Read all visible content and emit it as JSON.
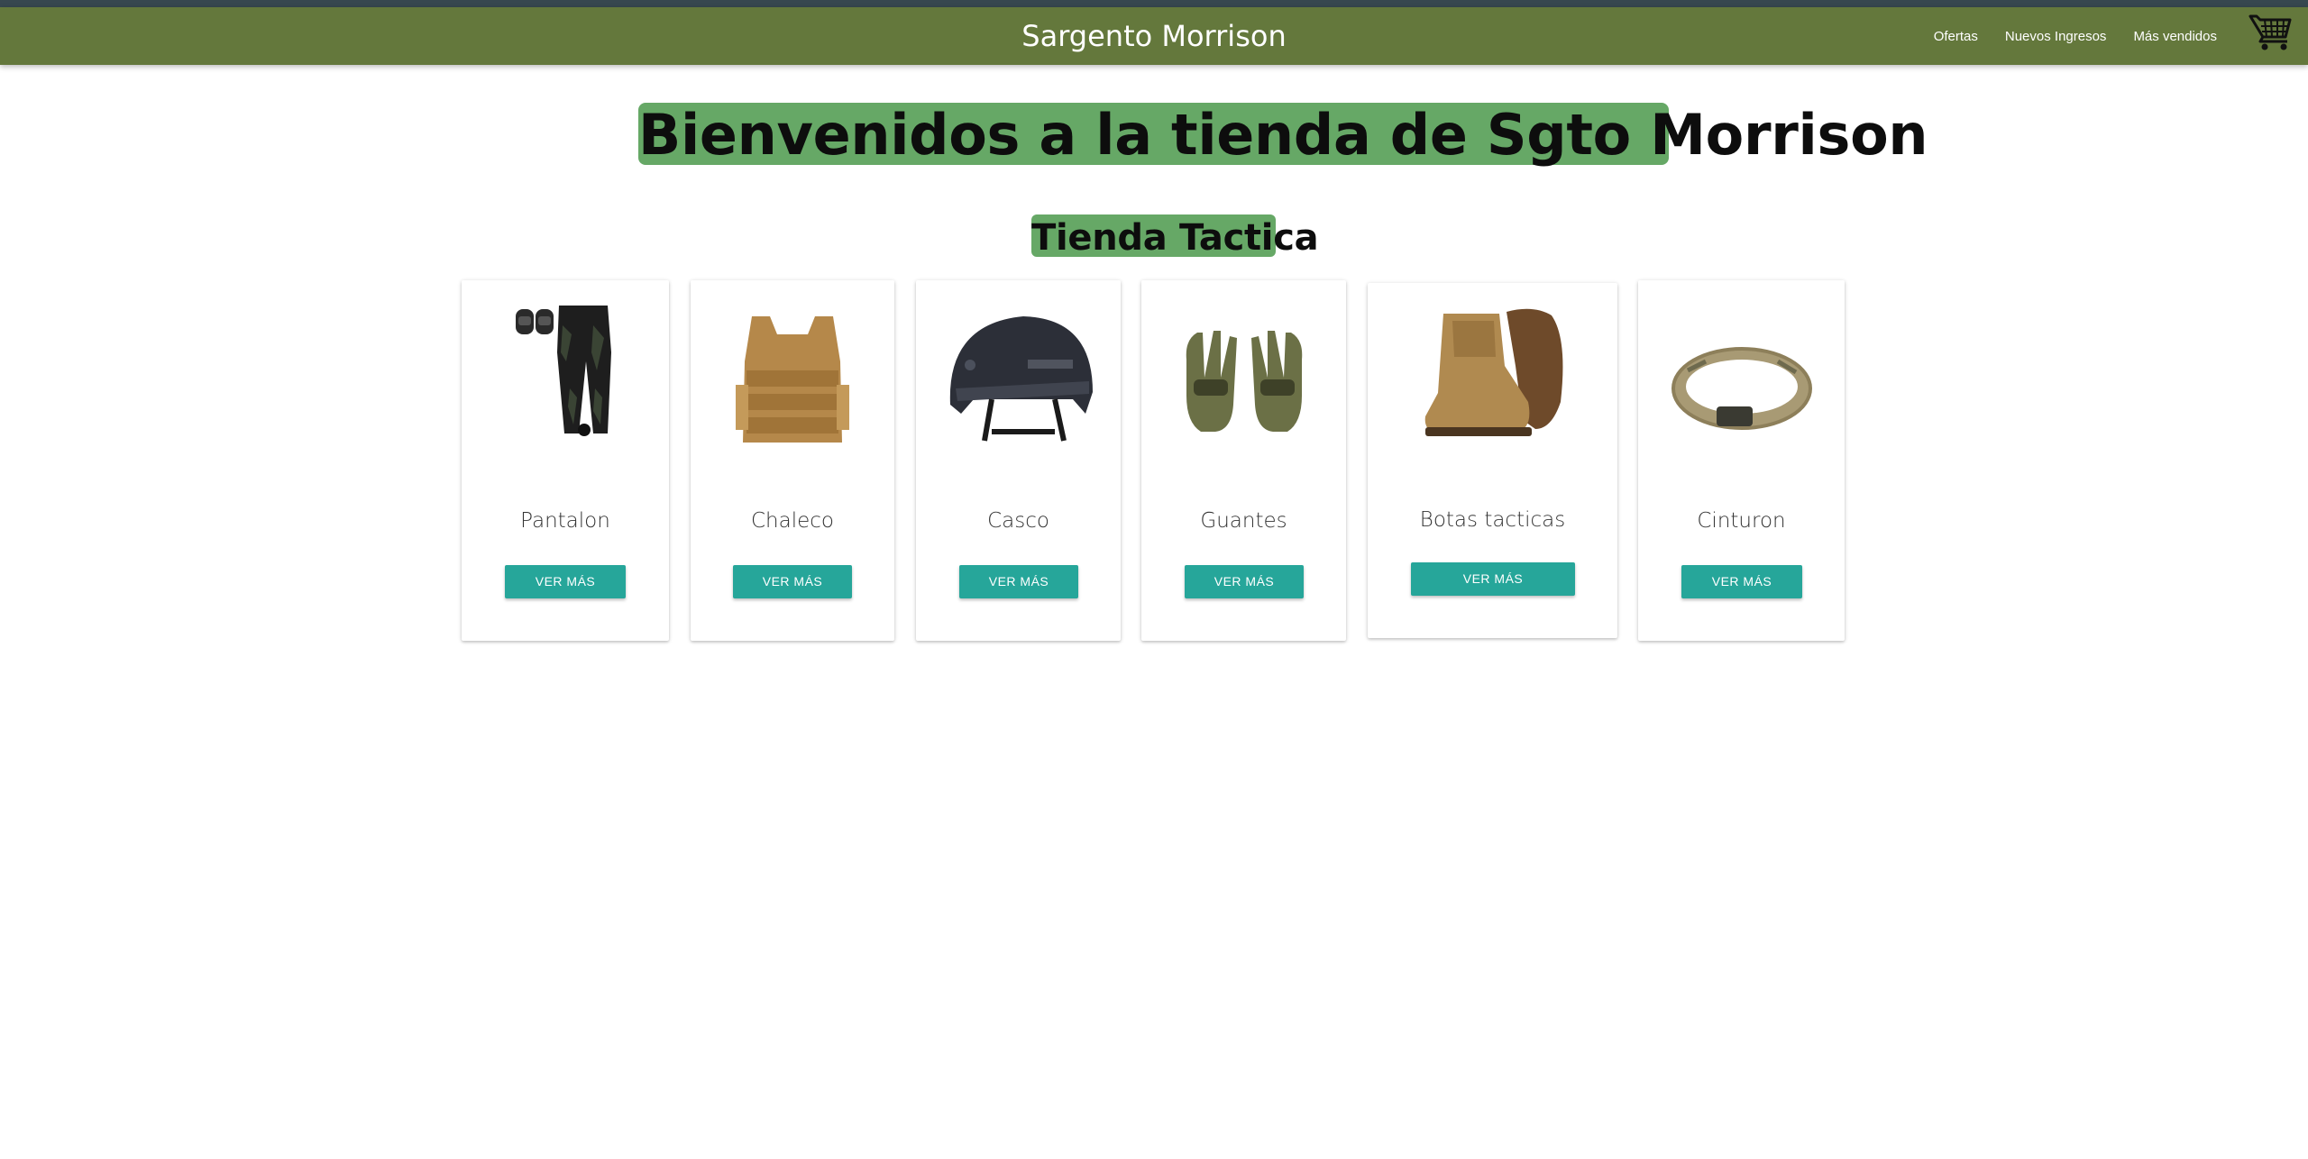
{
  "header": {
    "brand": "Sargento Morrison",
    "links": [
      "Ofertas",
      "Nuevos Ingresos",
      "Más vendidos"
    ],
    "cart_icon": "shopping-cart-icon",
    "colors": {
      "navbar": "#64783c",
      "top_strip": "#37474f"
    }
  },
  "main": {
    "title": "Bienvenidos a la tienda de Sgto Morrison",
    "subtitle": "Tienda Tactica",
    "highlight_color": "#66a866",
    "button_color": "#26a69a"
  },
  "products": [
    {
      "name": "Pantalon",
      "button": "VER MÁS",
      "image": "camo-pants-with-kneepads"
    },
    {
      "name": "Chaleco",
      "button": "VER MÁS",
      "image": "coyote-plate-carrier-vest"
    },
    {
      "name": "Casco",
      "button": "VER MÁS",
      "image": "black-tactical-helmet"
    },
    {
      "name": "Guantes",
      "button": "VER MÁS",
      "image": "olive-tactical-gloves"
    },
    {
      "name": "Botas tacticas",
      "button": "VER MÁS",
      "image": "tan-tactical-boots"
    },
    {
      "name": "Cinturon",
      "button": "VER MÁS",
      "image": "multicam-tactical-belt"
    }
  ]
}
